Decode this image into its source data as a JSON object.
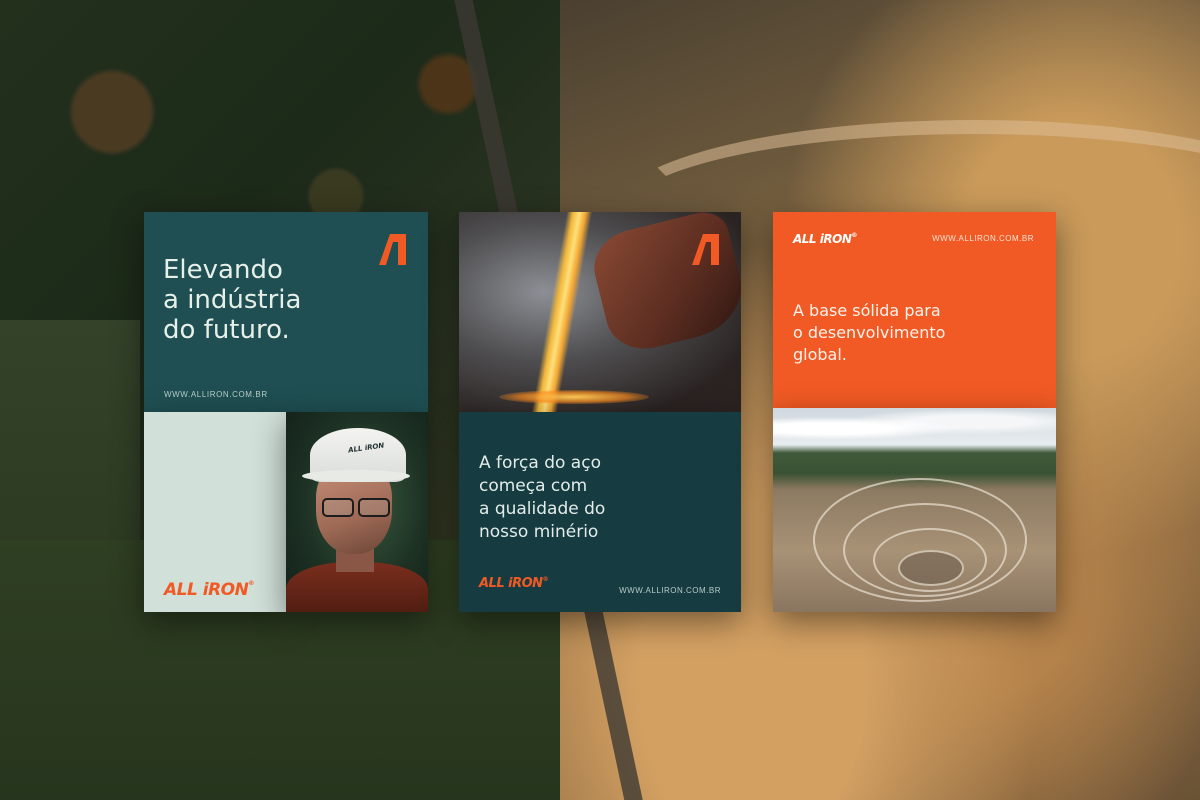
{
  "brand": {
    "name": "ALL iRON",
    "registered": "®",
    "helmet_text": "ALL iRON",
    "url": "WWW.ALLIRON.COM.BR",
    "colors": {
      "orange": "#f15a24",
      "teal": "#1f4f52",
      "dark_teal": "#163b41",
      "mint": "#d1e0d8"
    }
  },
  "card1": {
    "headline": [
      "Elevando",
      "a indústria",
      "do futuro."
    ],
    "url": "WWW.ALLIRON.COM.BR",
    "mark_icon": "brand-mark-icon",
    "logo": "ALL iRON"
  },
  "card2": {
    "mark_icon": "brand-mark-icon",
    "body": [
      "A força do aço",
      "começa com",
      "a qualidade do",
      "nosso minério"
    ],
    "logo": "ALL iRON",
    "url": "WWW.ALLIRON.COM.BR"
  },
  "card3": {
    "logo": "ALL iRON",
    "url": "WWW.ALLIRON.COM.BR",
    "body": [
      "A base sólida para",
      "o desenvolvimento",
      "global."
    ]
  }
}
